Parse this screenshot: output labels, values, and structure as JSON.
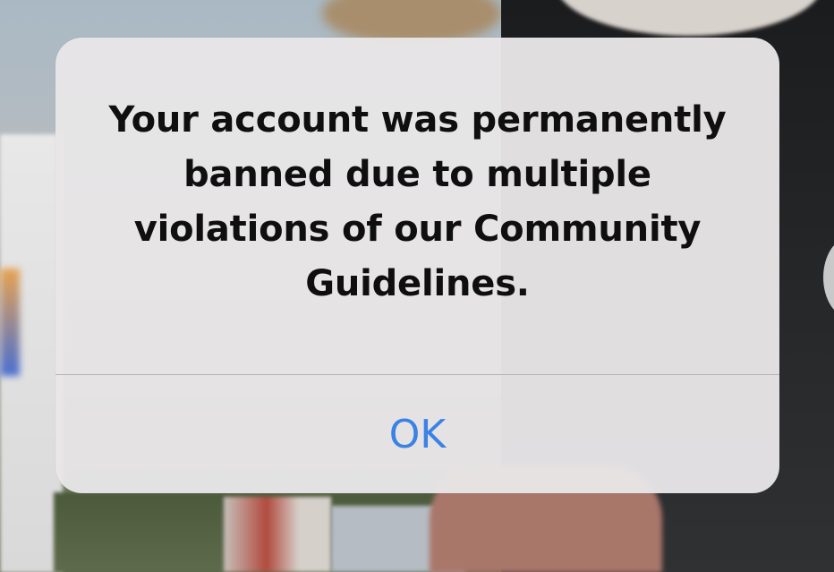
{
  "alert": {
    "message": "Your account was permanently banned due to multiple violations of our Community Guidelines.",
    "ok_label": "OK"
  },
  "colors": {
    "accent": "#3b82e6",
    "alert_background": "#e8e6e7",
    "text": "#0f0f0f"
  }
}
